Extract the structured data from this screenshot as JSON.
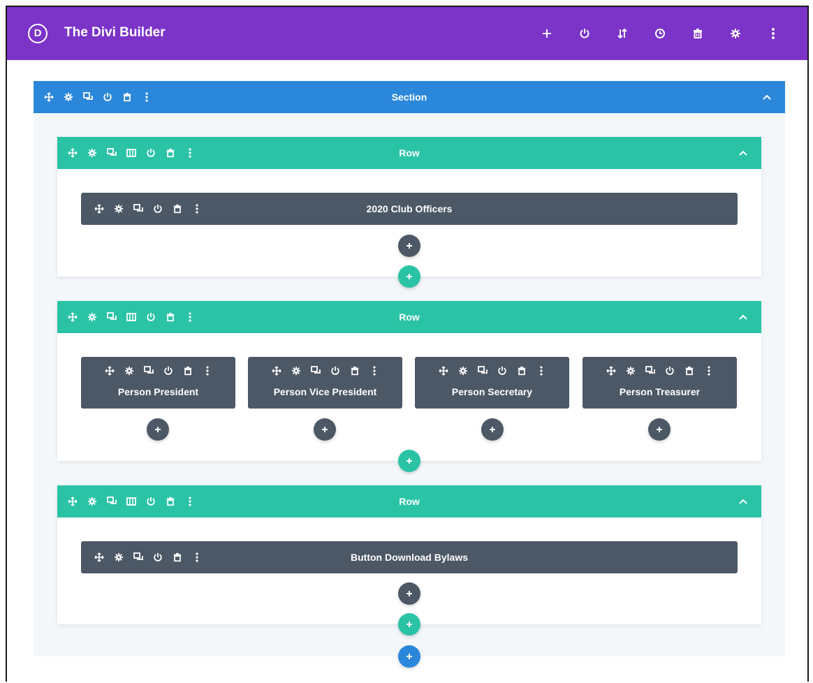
{
  "app": {
    "logo_letter": "D",
    "title": "The Divi Builder",
    "actions": [
      "plus-icon",
      "power-icon",
      "sort-icon",
      "history-icon",
      "trash-icon",
      "gear-icon",
      "more-icon"
    ]
  },
  "section": {
    "label": "Section"
  },
  "rows": [
    {
      "label": "Row",
      "modules": [
        {
          "label": "2020 Club Officers"
        }
      ]
    },
    {
      "label": "Row",
      "modules": [
        {
          "label": "Person President"
        },
        {
          "label": "Person Vice President"
        },
        {
          "label": "Person Secretary"
        },
        {
          "label": "Person Treasurer"
        }
      ]
    },
    {
      "label": "Row",
      "modules": [
        {
          "label": "Button Download Bylaws"
        }
      ]
    }
  ],
  "colors": {
    "topbar": "#7b33c8",
    "section": "#2b87da",
    "row": "#2bc3a6",
    "module": "#4c5866",
    "section_bg": "#f3f7fa"
  }
}
